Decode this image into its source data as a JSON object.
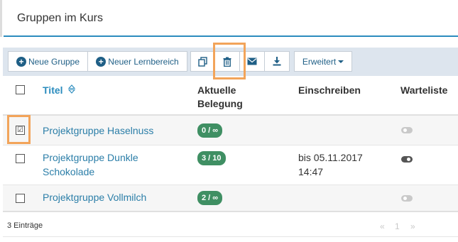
{
  "header": {
    "title": "Gruppen im Kurs"
  },
  "toolbar": {
    "new_group": "Neue Gruppe",
    "new_area": "Neuer Lernbereich",
    "extended": "Erweitert"
  },
  "table": {
    "headers": {
      "title": "Titel",
      "occupancy_line1": "Aktuelle",
      "occupancy_line2": "Belegung",
      "enroll": "Einschreiben",
      "waitlist": "Warteliste"
    },
    "rows": [
      {
        "name": "Projektgruppe Haselnuss",
        "occupancy": "0 / ∞",
        "enroll_line1": "",
        "enroll_line2": "",
        "waitlist": "off",
        "checked": true
      },
      {
        "name_line1": "Projektgruppe Dunkle",
        "name_line2": "Schokolade",
        "occupancy": "3 / 10",
        "enroll_line1": "bis 05.11.2017",
        "enroll_line2": "14:47",
        "waitlist": "on",
        "checked": false
      },
      {
        "name": "Projektgruppe Vollmilch",
        "occupancy": "2 / ∞",
        "enroll_line1": "",
        "enroll_line2": "",
        "waitlist": "off",
        "checked": false
      }
    ]
  },
  "footer": {
    "count": "3 Einträge",
    "pager_prev": "«",
    "pager_page": "1",
    "pager_next": "»"
  },
  "icons": {
    "copy": "copy-icon",
    "delete": "trash-icon",
    "mail": "envelope-icon",
    "download": "download-icon",
    "sort": "sort-icon"
  },
  "colors": {
    "accent": "#2b8cbe",
    "link": "#2b7ea8",
    "badge": "#3f8f63",
    "toolbar_bg": "#dde5ee",
    "highlight": "#f2a45a"
  }
}
